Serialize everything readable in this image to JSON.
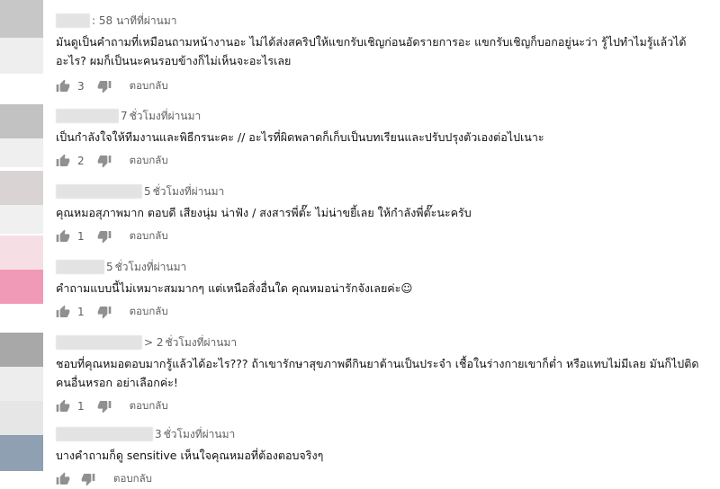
{
  "avatars": [
    {
      "color": "#c7c7c7"
    },
    {
      "color": "#eeeeee"
    },
    {
      "color": "#c2c2c2"
    },
    {
      "color": "#efefef"
    },
    {
      "color": "#d9d3d4"
    },
    {
      "color": "#f0f0f0"
    },
    {
      "color": "#f5dfe4"
    },
    {
      "color": "#f19ab7"
    },
    {
      "color": "#a8a8a8"
    },
    {
      "color": "#ededed"
    },
    {
      "color": "#e6e6e6"
    },
    {
      "color": "#8ea0b1"
    }
  ],
  "comments": [
    {
      "author_suffix": ": 58",
      "time": "นาทีที่ผ่านมา",
      "text": "มันดูเป็นคำถามที่เหมือนถามหน้างานอะ ไม่ได้ส่งสคริปให้แขกรับเชิญก่อนอัดรายการอะ แขกรับเชิญก็บอกอยู่นะว่า รู้ไปทำไมรู้แล้วได้อะไร? ผมก็เป็นนะคนรอบข้างก็ไม่เห็นจะอะไรเลย",
      "likes": "3",
      "reply": "ตอบกลับ"
    },
    {
      "author_suffix": "7",
      "time": "ชั่วโมงที่ผ่านมา",
      "text": "เป็นกำลังใจให้ทีมงานและพิธีกรนะคะ // อะไรที่ผิดพลาดก็เก็บเป็นบทเรียนและปรับปรุงตัวเองต่อไปเนาะ",
      "likes": "2",
      "reply": "ตอบกลับ"
    },
    {
      "author_suffix": "5",
      "time": "ชั่วโมงที่ผ่านมา",
      "text": "คุณหมอสุภาพมาก ตอบดี เสียงนุ่ม น่าฟัง / สงสารพี่ตั๊ะ ไม่น่าขยี้เลย ให้กำลังพี่ตั๊ะนะครับ",
      "likes": "1",
      "reply": "ตอบกลับ"
    },
    {
      "author_suffix": "5",
      "time": "ชั่วโมงที่ผ่านมา",
      "text": "คำถามแบบนี้ไม่เหมาะสมมากๆ แต่เหนือสิ่งอื่นใด คุณหมอน่ารักจังเลยค่ะ☺",
      "likes": "1",
      "reply": "ตอบกลับ"
    },
    {
      "author_suffix": "> 2",
      "time": "ชั่วโมงที่ผ่านมา",
      "text": "ชอบที่คุณหมอตอบมากรู้แล้วได้อะไร??? ถ้าเขารักษาสุขภาพดีกินยาต้านเป็นประจำ เชื้อในร่างกายเขาก็ต่ำ หรือแทบไม่มีเลย มันก็ไปติดคนอื่นหรอก อย่าเลือกค่ะ!",
      "likes": "1",
      "reply": "ตอบกลับ"
    },
    {
      "author_suffix": "3",
      "time": "ชั่วโมงที่ผ่านมา",
      "text": "บางคำถามก็ดู sensitive เห็นใจคุณหมอที่ต้องตอบจริงๆ",
      "likes": "",
      "reply": "ตอบกลับ"
    }
  ]
}
